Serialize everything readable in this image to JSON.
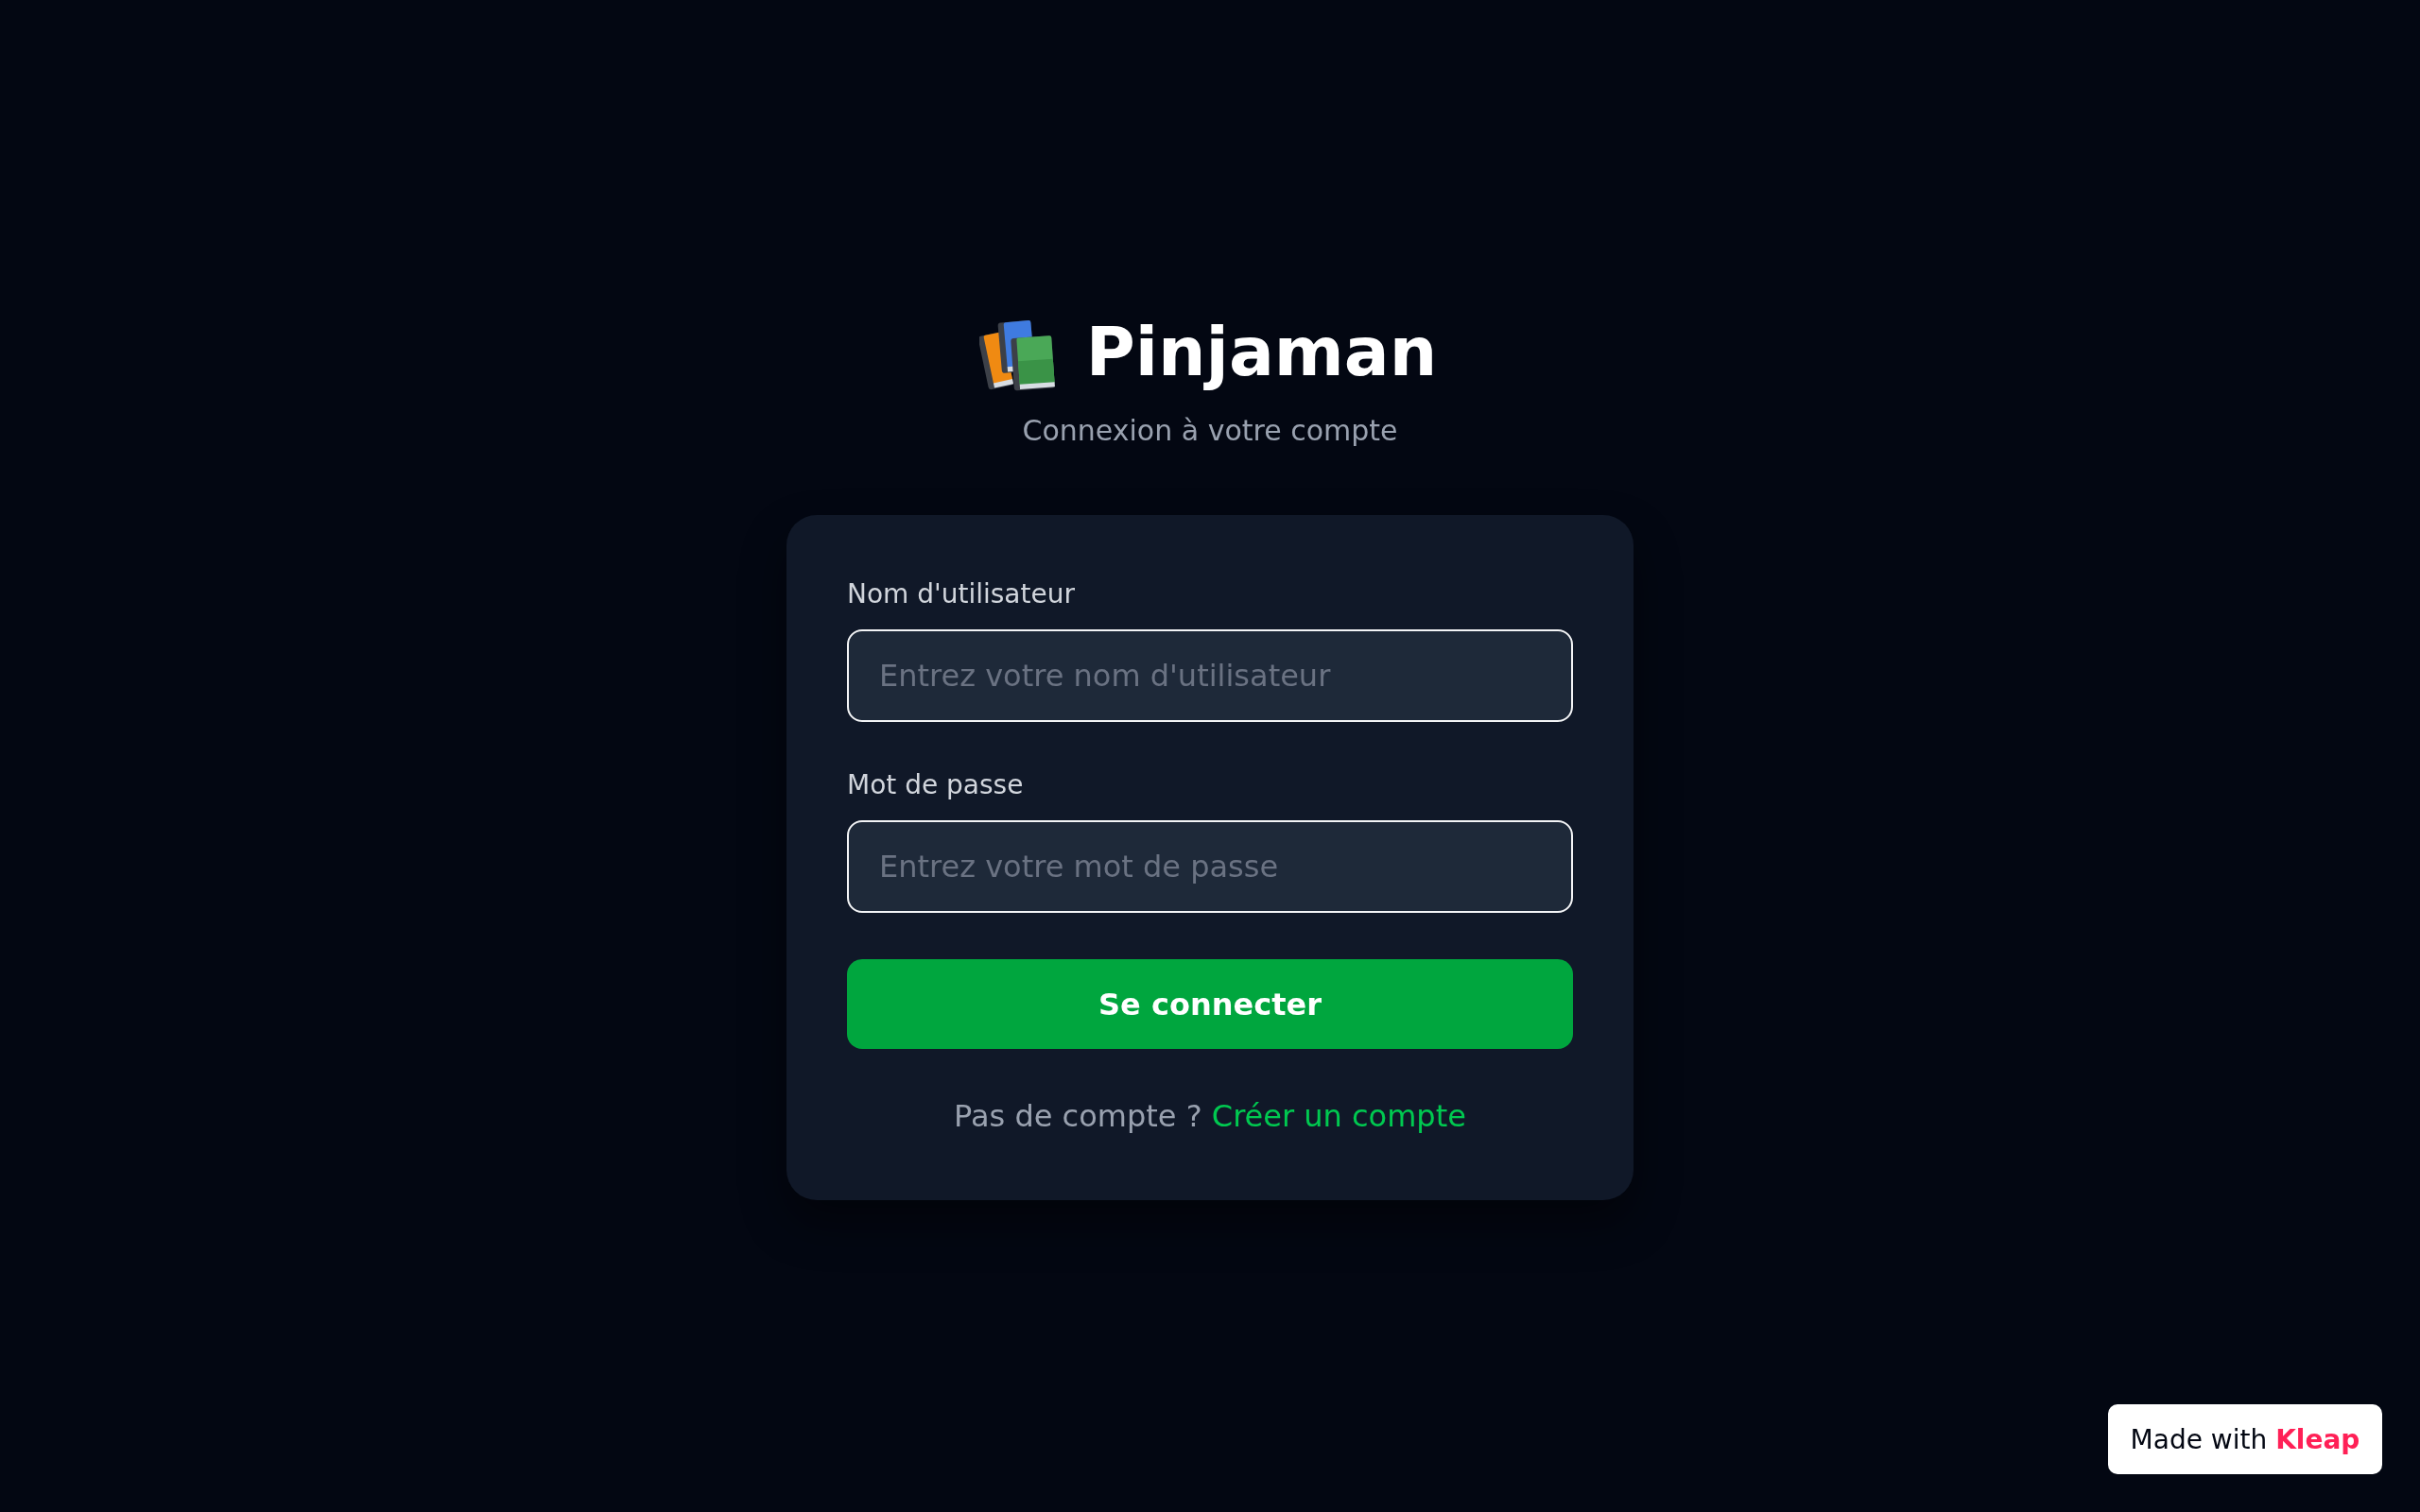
{
  "brand": {
    "title": "Pinjaman",
    "subtitle": "Connexion à votre compte"
  },
  "form": {
    "fields": [
      {
        "label": "Nom d'utilisateur",
        "placeholder": "Entrez votre nom d'utilisateur"
      },
      {
        "label": "Mot de passe",
        "placeholder": "Entrez votre mot de passe"
      }
    ],
    "submit": "Se connecter",
    "signup": {
      "prompt": "Pas de compte ?",
      "link": "Créer un compte"
    }
  },
  "badge": {
    "text": "Made with **Kleap**"
  }
}
